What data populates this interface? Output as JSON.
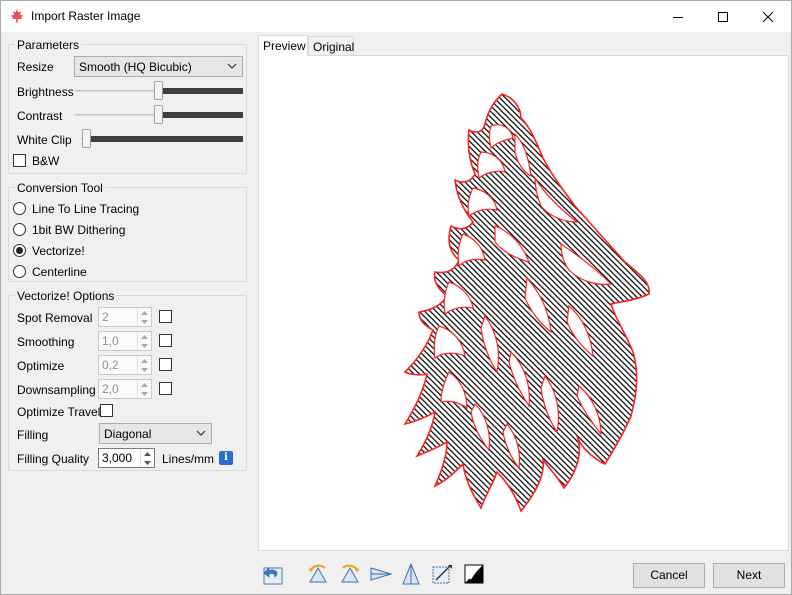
{
  "window": {
    "title": "Import Raster Image"
  },
  "parameters": {
    "title": "Parameters",
    "resize_label": "Resize",
    "resize_value": "Smooth (HQ Bicubic)",
    "brightness_label": "Brightness",
    "brightness_level": 0.5,
    "contrast_label": "Contrast",
    "contrast_level": 0.5,
    "whiteclip_label": "White Clip",
    "whiteclip_level": 0.03,
    "bw_label": "B&W"
  },
  "conversion": {
    "title": "Conversion Tool",
    "options": [
      "Line To Line Tracing",
      "1bit BW Dithering",
      "Vectorize!",
      "Centerline"
    ],
    "selected": "Vectorize!"
  },
  "vectorize": {
    "title": "Vectorize! Options",
    "spot_removal_label": "Spot Removal",
    "spot_removal_value": "2",
    "smoothing_label": "Smoothing",
    "smoothing_value": "1,0",
    "optimize_label": "Optimize",
    "optimize_value": "0,2",
    "downsampling_label": "Downsampling",
    "downsampling_value": "2,0",
    "optimize_travel_label": "Optimize Travel",
    "filling_label": "Filling",
    "filling_value": "Diagonal",
    "filling_quality_label": "Filling Quality",
    "filling_quality_value": "3,000",
    "filling_quality_unit": "Lines/mm"
  },
  "tabs": [
    "Preview",
    "Original"
  ],
  "buttons": {
    "cancel": "Cancel",
    "next": "Next"
  },
  "colors": {
    "outline": "#ff2020",
    "hatch": "#000000"
  }
}
